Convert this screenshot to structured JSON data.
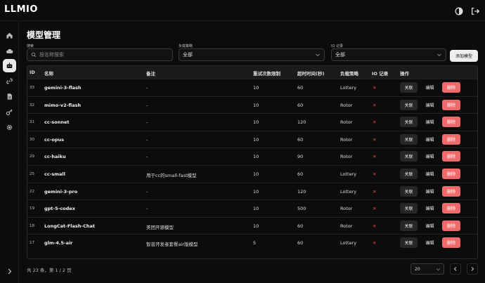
{
  "app": {
    "title": "LLMIO"
  },
  "page": {
    "title": "模型管理"
  },
  "filters": {
    "search_label": "搜索",
    "search_placeholder": "按名称搜索",
    "strategy_label": "负载策略",
    "strategy_value": "全部",
    "io_label": "IO 记录",
    "io_value": "全部",
    "add_button": "添加模型"
  },
  "table": {
    "headers": [
      "ID",
      "名称",
      "备注",
      "重试次数限制",
      "超时时间(秒)",
      "负载策略",
      "IO 记录",
      "操作"
    ],
    "actions": {
      "link": "关联",
      "edit": "编辑",
      "delete": "删除"
    },
    "io_mark": "✕",
    "rows": [
      {
        "id": "33",
        "name": "gemini-3-flash",
        "note": "-",
        "retry": "10",
        "timeout": "60",
        "strategy": "Lottery"
      },
      {
        "id": "32",
        "name": "mimo-v2-flash",
        "note": "-",
        "retry": "10",
        "timeout": "60",
        "strategy": "Rotor"
      },
      {
        "id": "31",
        "name": "cc-sonnet",
        "note": "-",
        "retry": "10",
        "timeout": "120",
        "strategy": "Rotor"
      },
      {
        "id": "30",
        "name": "cc-opus",
        "note": "-",
        "retry": "10",
        "timeout": "60",
        "strategy": "Rotor"
      },
      {
        "id": "29",
        "name": "cc-haiku",
        "note": "-",
        "retry": "10",
        "timeout": "90",
        "strategy": "Rotor"
      },
      {
        "id": "25",
        "name": "cc-small",
        "note": "用于cc的small-fast模型",
        "retry": "10",
        "timeout": "60",
        "strategy": "Lottery"
      },
      {
        "id": "22",
        "name": "gemini-3-pro",
        "note": "-",
        "retry": "10",
        "timeout": "120",
        "strategy": "Lottery"
      },
      {
        "id": "19",
        "name": "gpt-5-codex",
        "note": "-",
        "retry": "10",
        "timeout": "500",
        "strategy": "Rotor"
      },
      {
        "id": "18",
        "name": "LongCat-Flash-Chat",
        "note": "美团开源模型",
        "retry": "10",
        "timeout": "60",
        "strategy": "Rotor"
      },
      {
        "id": "17",
        "name": "glm-4.5-air",
        "note": "智普开发者套餐air版模型",
        "retry": "5",
        "timeout": "60",
        "strategy": "Lottery"
      }
    ]
  },
  "footer": {
    "summary": "共 23 条，第 1 / 2 页",
    "page_size": "20"
  },
  "icons": {
    "sidebar": [
      "home-icon",
      "cloud-icon",
      "bot-icon",
      "link-icon",
      "file-icon",
      "key-icon",
      "gear-icon"
    ],
    "accent_delete": "#ef6b6b",
    "accent_x": "#e5484d"
  }
}
